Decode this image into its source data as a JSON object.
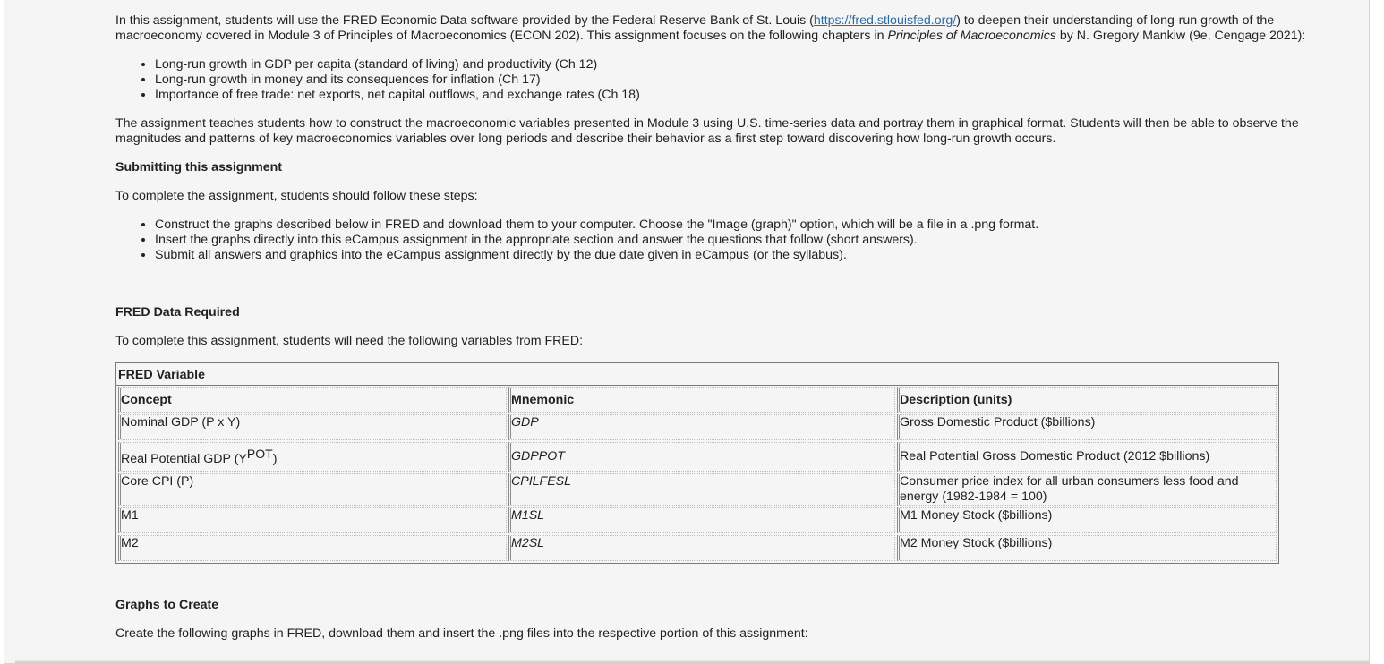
{
  "intro": {
    "text_before_link": "In this assignment, students will use the FRED Economic Data software provided by the Federal Reserve Bank of St. Louis (",
    "link_text": "https://fred.stlouisfed.org/",
    "text_mid": ") to deepen their understanding of long-run growth of the macroeconomy covered in Module 3 of Principles of Macroeconomics (ECON 202). This assignment focuses on the following chapters in ",
    "book_title": "Principles of Macroeconomics",
    "text_after": " by N. Gregory Mankiw (9e, Cengage 2021):"
  },
  "chapters": [
    "Long-run growth in GDP per capita (standard of living) and productivity (Ch 12)",
    "Long-run growth in money and its consequences for inflation (Ch 17)",
    "Importance of free trade: net exports, net capital outflows, and exchange rates (Ch 18)"
  ],
  "teaches": "The assignment teaches students how to construct the macroeconomic variables presented in Module 3 using U.S. time-series data and portray them in graphical format. Students will then be able to observe the magnitudes and patterns of key macroeconomics variables over long periods and describe their behavior as a first step toward discovering how long-run growth occurs.",
  "submitting": {
    "heading": "Submitting this assignment",
    "lead": "To complete the assignment, students should follow these steps:",
    "steps": [
      "Construct the graphs described below in FRED and download them to your computer. Choose the \"Image (graph)\" option, which will be a file in a .png format.",
      "Insert the graphs directly into this eCampus assignment in the appropriate section and answer the questions that follow (short answers).",
      "Submit all answers and graphics into the eCampus assignment directly by the due date given in eCampus (or the syllabus)."
    ]
  },
  "fred_data": {
    "heading": "FRED Data Required",
    "lead": "To complete this assignment, students will need the following variables from FRED:",
    "table": {
      "caption": "FRED Variable",
      "headers": [
        "Concept",
        "Mnemonic",
        "Description (units)"
      ],
      "rows": [
        {
          "concept": "Nominal GDP (P x Y)",
          "mnemonic": "GDP",
          "description": "Gross Domestic Product ($billions)"
        },
        {
          "concept_base": "Real Potential GDP (Y",
          "concept_sup": "POT",
          "concept_end": ")",
          "mnemonic": "GDPPOT",
          "description": "Real Potential Gross Domestic Product (2012 $billions)"
        },
        {
          "concept": "Core CPI (P)",
          "mnemonic": "CPILFESL",
          "description": "Consumer price index for all urban consumers less food and energy (1982-1984 = 100)"
        },
        {
          "concept": "M1",
          "mnemonic": "M1SL",
          "description": "M1 Money Stock ($billions)"
        },
        {
          "concept": "M2",
          "mnemonic": "M2SL",
          "description": "M2 Money Stock ($billions)"
        }
      ]
    }
  },
  "graphs": {
    "heading": "Graphs to Create",
    "lead": "Create the following graphs in FRED, download them and insert the .png files into the respective portion of this assignment:"
  }
}
